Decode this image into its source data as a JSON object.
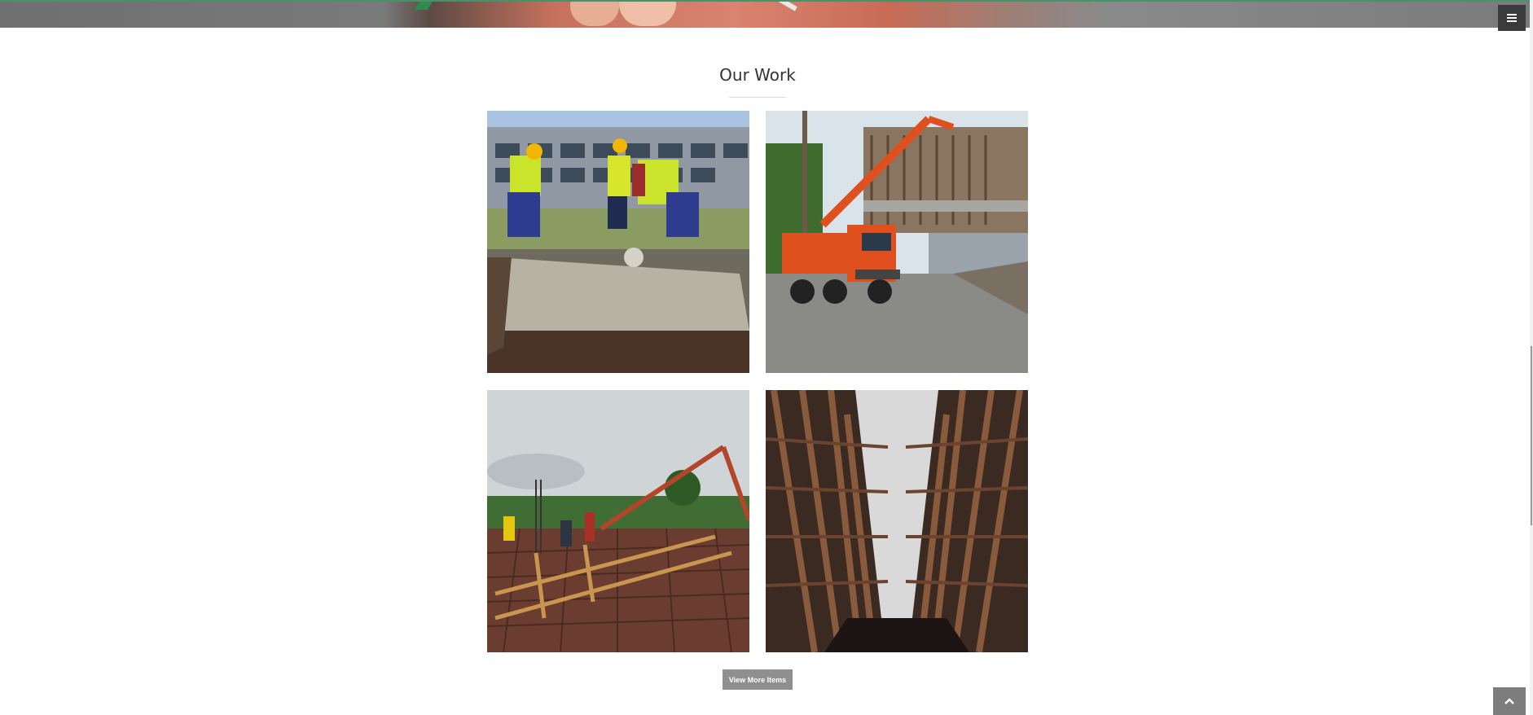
{
  "section": {
    "title": "Our Work"
  },
  "gallery": {
    "items": [
      {
        "alt": "Workers leveling concrete",
        "icon": "photo-workers-concrete"
      },
      {
        "alt": "Concrete pump truck",
        "icon": "photo-pump-truck"
      },
      {
        "alt": "Rebar slab pouring",
        "icon": "photo-rebar-slab"
      },
      {
        "alt": "Timber formwork scaffolding",
        "icon": "photo-formwork"
      }
    ],
    "view_more_label": "View More Items"
  },
  "nav": {
    "menu_icon": "hamburger-icon",
    "scroll_top_icon": "chevron-up-icon"
  },
  "colors": {
    "menu_bg": "#3b3b3b",
    "button_bg": "#8f8f8f",
    "scroll_top_bg": "#7d7d7d"
  }
}
